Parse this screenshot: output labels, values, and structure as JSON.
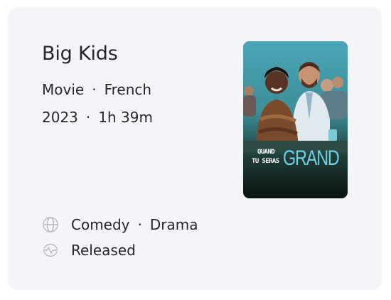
{
  "title": "Big Kids",
  "meta": {
    "type": "Movie",
    "language": "French",
    "year": "2023",
    "runtime": "1h 39m",
    "separator": "·"
  },
  "poster": {
    "line1": "QUAND",
    "line2": "TU SERAS",
    "big": "GRAND",
    "accent_color": "#6fd0e3"
  },
  "genres": {
    "icon": "globe-icon",
    "items": [
      "Comedy",
      "Drama"
    ]
  },
  "status": {
    "icon": "activity-pulse-icon",
    "label": "Released"
  },
  "colors": {
    "card_background": "#f4f5f9",
    "text": "#23262f",
    "icon": "#b7bac2"
  }
}
